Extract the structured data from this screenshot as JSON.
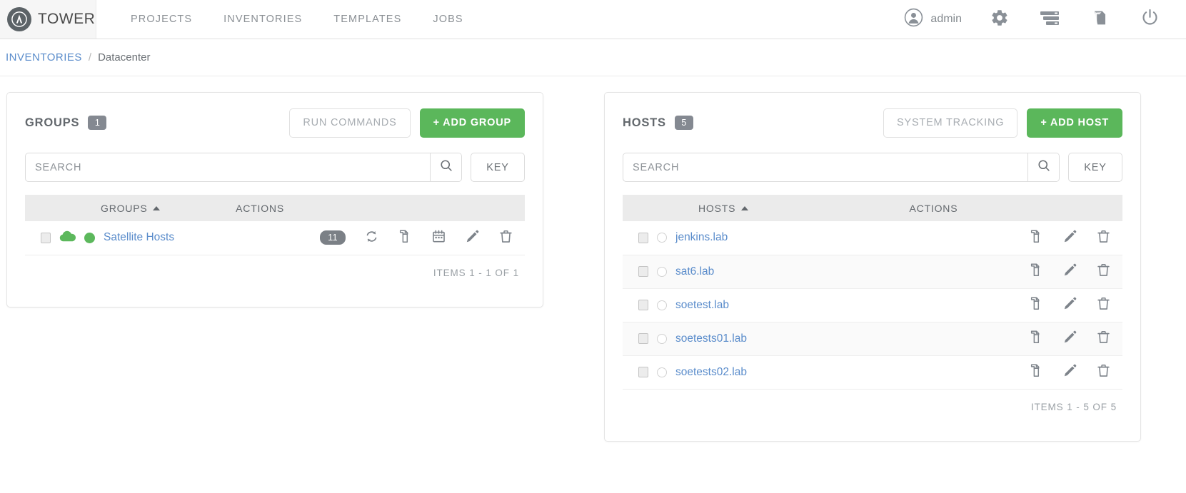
{
  "topnav": {
    "brand": "TOWER",
    "links": [
      "PROJECTS",
      "INVENTORIES",
      "TEMPLATES",
      "JOBS"
    ],
    "user": "admin",
    "icons": [
      "user-icon",
      "gear-icon",
      "server-stack-icon",
      "book-icon",
      "power-icon"
    ]
  },
  "breadcrumb": {
    "parent": "INVENTORIES",
    "separator": "/",
    "current": "Datacenter"
  },
  "groups_panel": {
    "title": "GROUPS",
    "count": "1",
    "run_commands_label": "RUN COMMANDS",
    "add_label": "+ ADD GROUP",
    "search_placeholder": "SEARCH",
    "key_label": "KEY",
    "col_name": "GROUPS",
    "col_actions": "ACTIONS",
    "rows": [
      {
        "name": "Satellite Hosts",
        "host_count": "11",
        "status": "success",
        "source": "cloud",
        "actions": [
          "sync-icon",
          "copy-icon",
          "calendar-icon",
          "pencil-icon",
          "trash-icon"
        ]
      }
    ],
    "footer": "ITEMS  1 - 1 OF 1"
  },
  "hosts_panel": {
    "title": "HOSTS",
    "count": "5",
    "system_tracking_label": "SYSTEM TRACKING",
    "add_label": "+ ADD HOST",
    "search_placeholder": "SEARCH",
    "key_label": "KEY",
    "col_name": "HOSTS",
    "col_actions": "ACTIONS",
    "rows": [
      {
        "name": "jenkins.lab",
        "actions": [
          "copy-icon",
          "pencil-icon",
          "trash-icon"
        ]
      },
      {
        "name": "sat6.lab",
        "actions": [
          "copy-icon",
          "pencil-icon",
          "trash-icon"
        ]
      },
      {
        "name": "soetest.lab",
        "actions": [
          "copy-icon",
          "pencil-icon",
          "trash-icon"
        ]
      },
      {
        "name": "soetests01.lab",
        "actions": [
          "copy-icon",
          "pencil-icon",
          "trash-icon"
        ]
      },
      {
        "name": "soetests02.lab",
        "actions": [
          "copy-icon",
          "pencil-icon",
          "trash-icon"
        ]
      }
    ],
    "footer": "ITEMS  1 - 5 OF 5"
  },
  "colors": {
    "link": "#5a8ccb",
    "green": "#5bb75b",
    "status_green": "#5cb85c",
    "badge_gray": "#848991",
    "text_gray": "#63686d",
    "icon_gray": "#8a9097"
  }
}
